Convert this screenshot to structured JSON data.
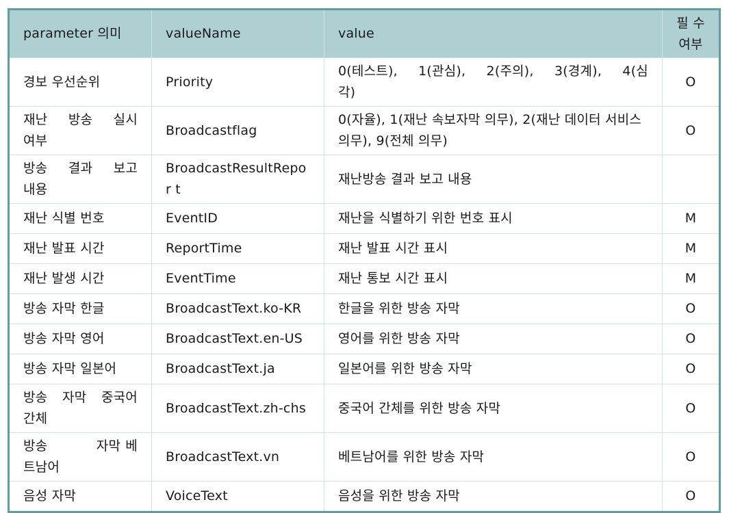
{
  "table": {
    "headers": {
      "param": "parameter 의미",
      "valueName": "valueName",
      "value": "value",
      "required_line1": "필 수",
      "required_line2": "여부"
    },
    "rows": [
      {
        "param": "경보 우선순위",
        "valueName": "Priority",
        "value": "0(테스트),   1(관심),   2(주의),   3(경계), 4(심각)",
        "required": "O"
      },
      {
        "param": "재난  방송  실시 여부",
        "valueName": "Broadcastflag",
        "value": "0(자율), 1(재난 속보자막 의무), 2(재난 데이터 서비스 의무), 9(전체 의무)",
        "required": "O"
      },
      {
        "param": "방송  결과  보고 내용",
        "valueName": "BroadcastResultRepor t",
        "value": "재난방송 결과 보고 내용",
        "required": ""
      },
      {
        "param": "재난 식별 번호",
        "valueName": "EventID",
        "value": "재난을 식별하기 위한 번호 표시",
        "required": "M"
      },
      {
        "param": "재난 발표 시간",
        "valueName": "ReportTime",
        "value": "재난 발표 시간 표시",
        "required": "M"
      },
      {
        "param": "재난 발생 시간",
        "valueName": "EventTime",
        "value": "재난 통보 시간 표시",
        "required": "M"
      },
      {
        "param": "방송 자막 한글",
        "valueName": "BroadcastText.ko-KR",
        "value": "한글을 위한 방송 자막",
        "required": "O"
      },
      {
        "param": "방송 자막 영어",
        "valueName": "BroadcastText.en-US",
        "value": "영어를 위한 방송 자막",
        "required": "O"
      },
      {
        "param": "방송 자막 일본어",
        "valueName": "BroadcastText.ja",
        "value": "일본어를 위한 방송 자막",
        "required": "O"
      },
      {
        "param": "방송  자막  중국어 간체",
        "valueName": "BroadcastText.zh-chs",
        "value": "중국어 간체를 위한 방송 자막",
        "required": "O"
      },
      {
        "param": "방송          자막 베트남어",
        "valueName": "BroadcastText.vn",
        "value": "베트남어를 위한 방송 자막",
        "required": "O"
      },
      {
        "param": "음성 자막",
        "valueName": "VoiceText",
        "value": "음성을 위한 방송 자막",
        "required": "O"
      }
    ]
  }
}
